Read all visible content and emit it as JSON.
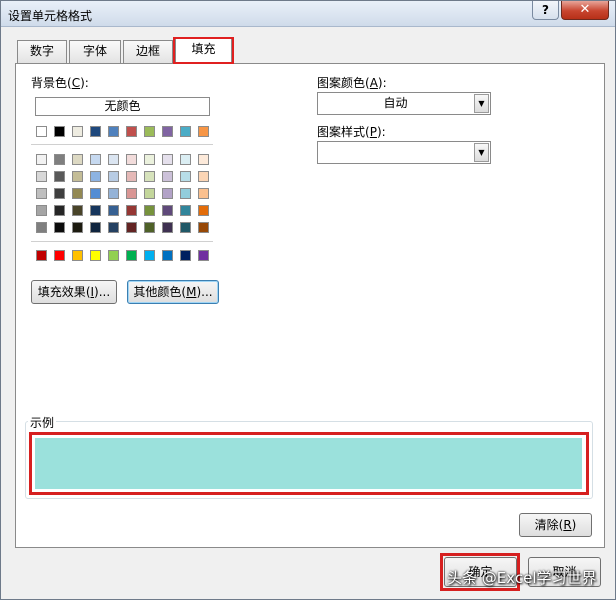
{
  "window": {
    "title": "设置单元格格式",
    "help": "?",
    "close": "✕"
  },
  "tabs": [
    {
      "label": "数字",
      "active": false
    },
    {
      "label": "字体",
      "active": false
    },
    {
      "label": "边框",
      "active": false
    },
    {
      "label": "填充",
      "active": true
    }
  ],
  "background": {
    "label": "背景色",
    "hotkey": "C",
    "no_color_label": "无颜色",
    "theme_top_row": [
      "#ffffff",
      "#000000",
      "#eeece1",
      "#1f497d",
      "#4f81bd",
      "#c0504d",
      "#9bbb59",
      "#8064a2",
      "#4bacc6",
      "#f79646"
    ],
    "theme_grid": [
      [
        "#f2f2f2",
        "#7f7f7f",
        "#ddd9c3",
        "#c6d9f0",
        "#dbe5f1",
        "#f2dcdb",
        "#ebf1dd",
        "#e5e0ec",
        "#dbeef3",
        "#fdeada"
      ],
      [
        "#d8d8d8",
        "#595959",
        "#c4bd97",
        "#8db3e2",
        "#b8cce4",
        "#e5b9b7",
        "#d7e3bc",
        "#ccc1d9",
        "#b7dde8",
        "#fbd5b5"
      ],
      [
        "#bfbfbf",
        "#3f3f3f",
        "#938953",
        "#548dd4",
        "#95b3d7",
        "#d99694",
        "#c3d69b",
        "#b2a2c7",
        "#92cddc",
        "#fac08f"
      ],
      [
        "#a5a5a5",
        "#262626",
        "#494429",
        "#17365d",
        "#366092",
        "#953734",
        "#76923c",
        "#5f497a",
        "#31859b",
        "#e36c09"
      ],
      [
        "#7f7f7f",
        "#0c0c0c",
        "#1d1b10",
        "#0f243e",
        "#244061",
        "#632423",
        "#4f6128",
        "#3f3151",
        "#205867",
        "#974806"
      ]
    ],
    "standard_row": [
      "#c00000",
      "#ff0000",
      "#ffc000",
      "#ffff00",
      "#92d050",
      "#00b050",
      "#00b0f0",
      "#0070c0",
      "#002060",
      "#7030a0"
    ]
  },
  "buttons": {
    "fill_effects": {
      "label": "填充效果",
      "hotkey": "I",
      "suffix": "..."
    },
    "more_colors": {
      "label": "其他颜色",
      "hotkey": "M",
      "suffix": "..."
    },
    "clear": {
      "label": "清除",
      "hotkey": "R"
    },
    "ok": "确定",
    "cancel": "取消"
  },
  "pattern": {
    "color_label": "图案颜色",
    "color_hotkey": "A",
    "color_value": "自动",
    "style_label": "图案样式",
    "style_hotkey": "P",
    "style_value": ""
  },
  "sample": {
    "label": "示例",
    "color": "#9be1dc"
  },
  "watermark": "头条 @Excel学习世界"
}
